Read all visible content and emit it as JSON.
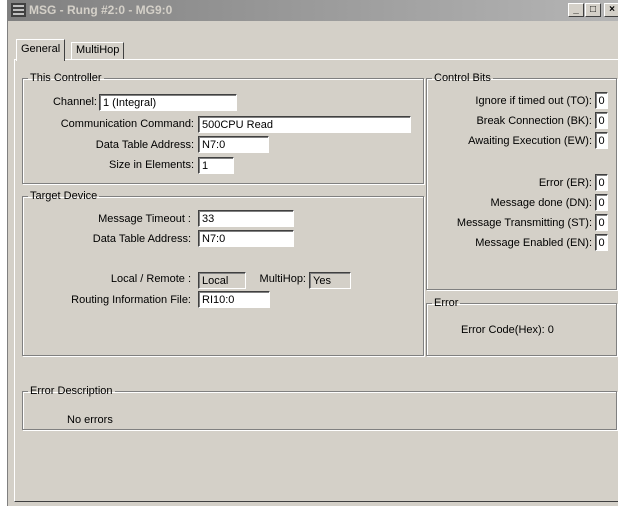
{
  "window": {
    "title": "MSG - Rung #2:0 - MG9:0",
    "min_label": "_",
    "max_label": "□",
    "close_label": "×"
  },
  "tabs": [
    {
      "label": "General"
    },
    {
      "label": "MultiHop"
    }
  ],
  "this_controller": {
    "legend": "This Controller",
    "channel_label": "Channel:",
    "channel_value": "1 (Integral)",
    "comm_label": "Communication Command:",
    "comm_value": "500CPU Read",
    "dta_label": "Data Table Address:",
    "dta_value": "N7:0",
    "size_label": "Size in Elements:",
    "size_value": "1"
  },
  "target_device": {
    "legend": "Target Device",
    "timeout_label": "Message Timeout :",
    "timeout_value": "33",
    "dta_label": "Data Table Address:",
    "dta_value": "N7:0",
    "local_remote_label": "Local / Remote :",
    "local_remote_value": "Local",
    "multihop_label": "MultiHop:",
    "multihop_value": "Yes",
    "routing_label": "Routing Information File:",
    "routing_value": "RI10:0"
  },
  "control_bits": {
    "legend": "Control Bits",
    "to_label": "Ignore if timed out (TO):",
    "to_value": "0",
    "bk_label": "Break Connection (BK):",
    "bk_value": "0",
    "ew_label": "Awaiting Execution (EW):",
    "ew_value": "0",
    "er_label": "Error (ER):",
    "er_value": "0",
    "dn_label": "Message done (DN):",
    "dn_value": "0",
    "st_label": "Message Transmitting (ST):",
    "st_value": "0",
    "en_label": "Message Enabled (EN):",
    "en_value": "0"
  },
  "error": {
    "legend": "Error",
    "code_label": "Error Code(Hex): 0"
  },
  "error_description": {
    "legend": "Error Description",
    "text": "No errors"
  },
  "colors": {
    "face": "#d4d0c8",
    "title_inactive_start": "#808080",
    "title_inactive_end": "#b5b5b5"
  }
}
